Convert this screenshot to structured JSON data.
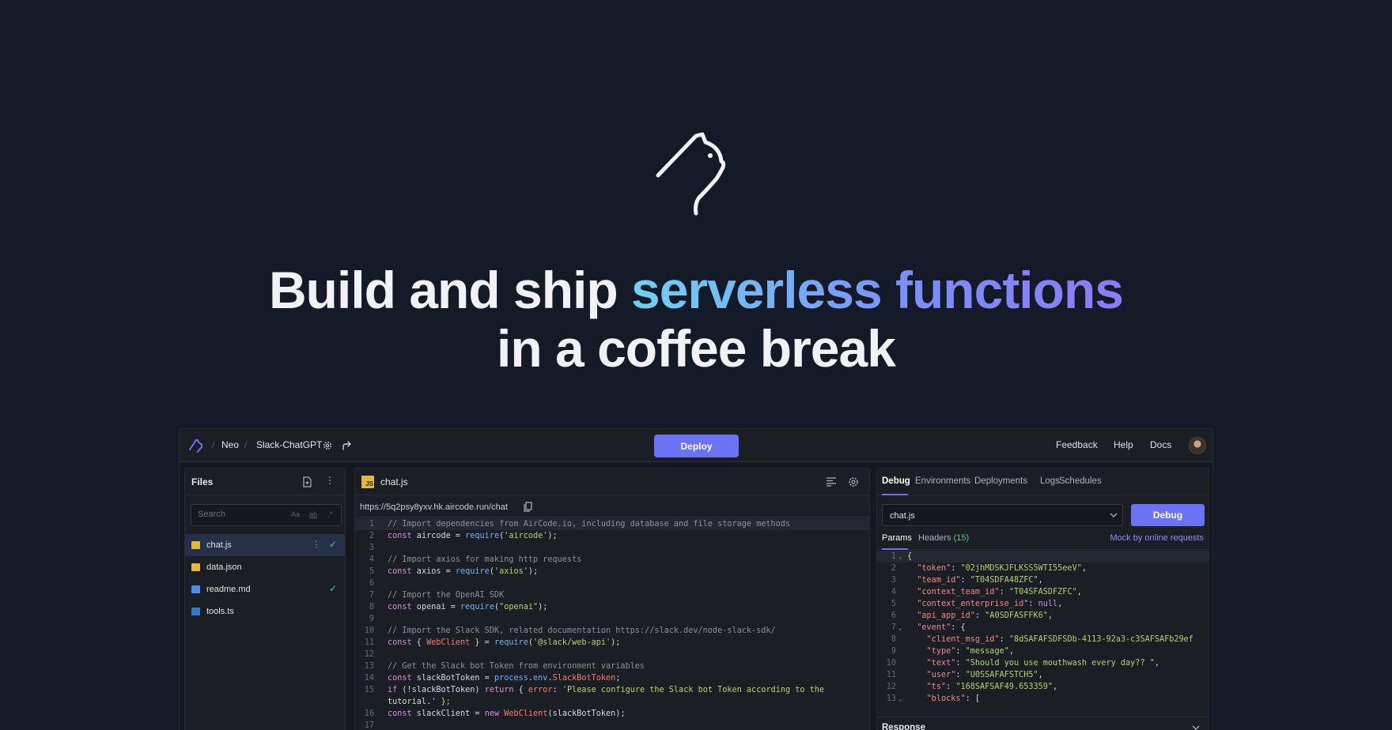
{
  "hero": {
    "title_part1": "Build and ship ",
    "title_highlight": "serverless functions",
    "title_part2": "in a coffee break"
  },
  "topbar": {
    "crumbs": [
      "Neo",
      "Slack-ChatGPT"
    ],
    "deploy_label": "Deploy",
    "links": [
      "Feedback",
      "Help",
      "Docs"
    ]
  },
  "files": {
    "title": "Files",
    "search_placeholder": "Search",
    "search_options": [
      "Aa",
      "ab",
      ".*"
    ],
    "items": [
      {
        "name": "chat.js",
        "icon": "js-file-icon",
        "icon_color": "#e2b93b",
        "check": true,
        "active": true
      },
      {
        "name": "data.json",
        "icon": "json-file-icon",
        "icon_color": "#e2b93b",
        "check": false,
        "active": false
      },
      {
        "name": "readme.md",
        "icon": "markdown-file-icon",
        "icon_color": "#4a8df0",
        "check": true,
        "active": false
      },
      {
        "name": "tools.ts",
        "icon": "ts-file-icon",
        "icon_color": "#3178c6",
        "check": false,
        "active": false
      }
    ]
  },
  "editor": {
    "filename": "chat.js",
    "url": "https://5q2psy8yxv.hk.aircode.run/chat",
    "lines": [
      {
        "n": "1",
        "t": "// Import dependencies from AirCode.io, including database and file storage methods"
      },
      {
        "n": "2",
        "t": "const aircode = require('aircode');"
      },
      {
        "n": "3",
        "t": ""
      },
      {
        "n": "4",
        "t": "// Import axios for making http requests"
      },
      {
        "n": "5",
        "t": "const axios = require('axios');"
      },
      {
        "n": "6",
        "t": ""
      },
      {
        "n": "7",
        "t": "// Import the OpenAI SDK"
      },
      {
        "n": "8",
        "t": "const openai = require(\"openai\");"
      },
      {
        "n": "9",
        "t": ""
      },
      {
        "n": "10",
        "t": "// Import the Slack SDK, related documentation https://slack.dev/node-slack-sdk/"
      },
      {
        "n": "11",
        "t": "const { WebClient } = require('@slack/web-api');"
      },
      {
        "n": "12",
        "t": ""
      },
      {
        "n": "13",
        "t": "// Get the Slack bot Token from environment variables"
      },
      {
        "n": "14",
        "t": "const slackBotToken = process.env.SlackBotToken;"
      },
      {
        "n": "15",
        "t": "if (!slackBotToken) return { error: 'Please configure the Slack bot Token according to the"
      },
      {
        "n": "",
        "t": "tutorial.' };"
      },
      {
        "n": "16",
        "t": "const slackClient = new WebClient(slackBotToken);"
      },
      {
        "n": "17",
        "t": ""
      }
    ]
  },
  "debug": {
    "tabs": [
      "Debug",
      "Environments",
      "Deployments",
      "Logs",
      "Schedules"
    ],
    "select_value": "chat.js",
    "debug_label": "Debug",
    "params_tab": "Params",
    "headers_tab": "Headers",
    "headers_count": "(15)",
    "mock_label": "Mock by online requests",
    "json_lines": [
      {
        "n": "1",
        "t": "{",
        "fold": true
      },
      {
        "n": "2",
        "t": "  \"token\": \"02jhMDSKJFLKSS5WTI55eeV\","
      },
      {
        "n": "3",
        "t": "  \"team_id\": \"T04SDFA48ZFC\","
      },
      {
        "n": "4",
        "t": "  \"context_team_id\": \"T04SFASDFZFC\","
      },
      {
        "n": "5",
        "t": "  \"context_enterprise_id\": null,"
      },
      {
        "n": "6",
        "t": "  \"api_app_id\": \"A0SDFASFFK6\","
      },
      {
        "n": "7",
        "t": "  \"event\": {",
        "fold": true
      },
      {
        "n": "8",
        "t": "    \"client_msg_id\": \"8dSAFAFSDFSDb-4113-92a3-c3SAFSAFb29ef"
      },
      {
        "n": "9",
        "t": "    \"type\": \"message\","
      },
      {
        "n": "10",
        "t": "    \"text\": \"Should you use mouthwash every day?? \","
      },
      {
        "n": "11",
        "t": "    \"user\": \"U0SSAFAFSTCH5\","
      },
      {
        "n": "12",
        "t": "    \"ts\": \"168SAFSAF49.653359\","
      },
      {
        "n": "13",
        "t": "    \"blocks\": [",
        "fold": true
      }
    ],
    "response_label": "Response"
  },
  "colors": {
    "accent": "#6b72f6",
    "background": "#141a27",
    "panel": "#1b1e25"
  }
}
